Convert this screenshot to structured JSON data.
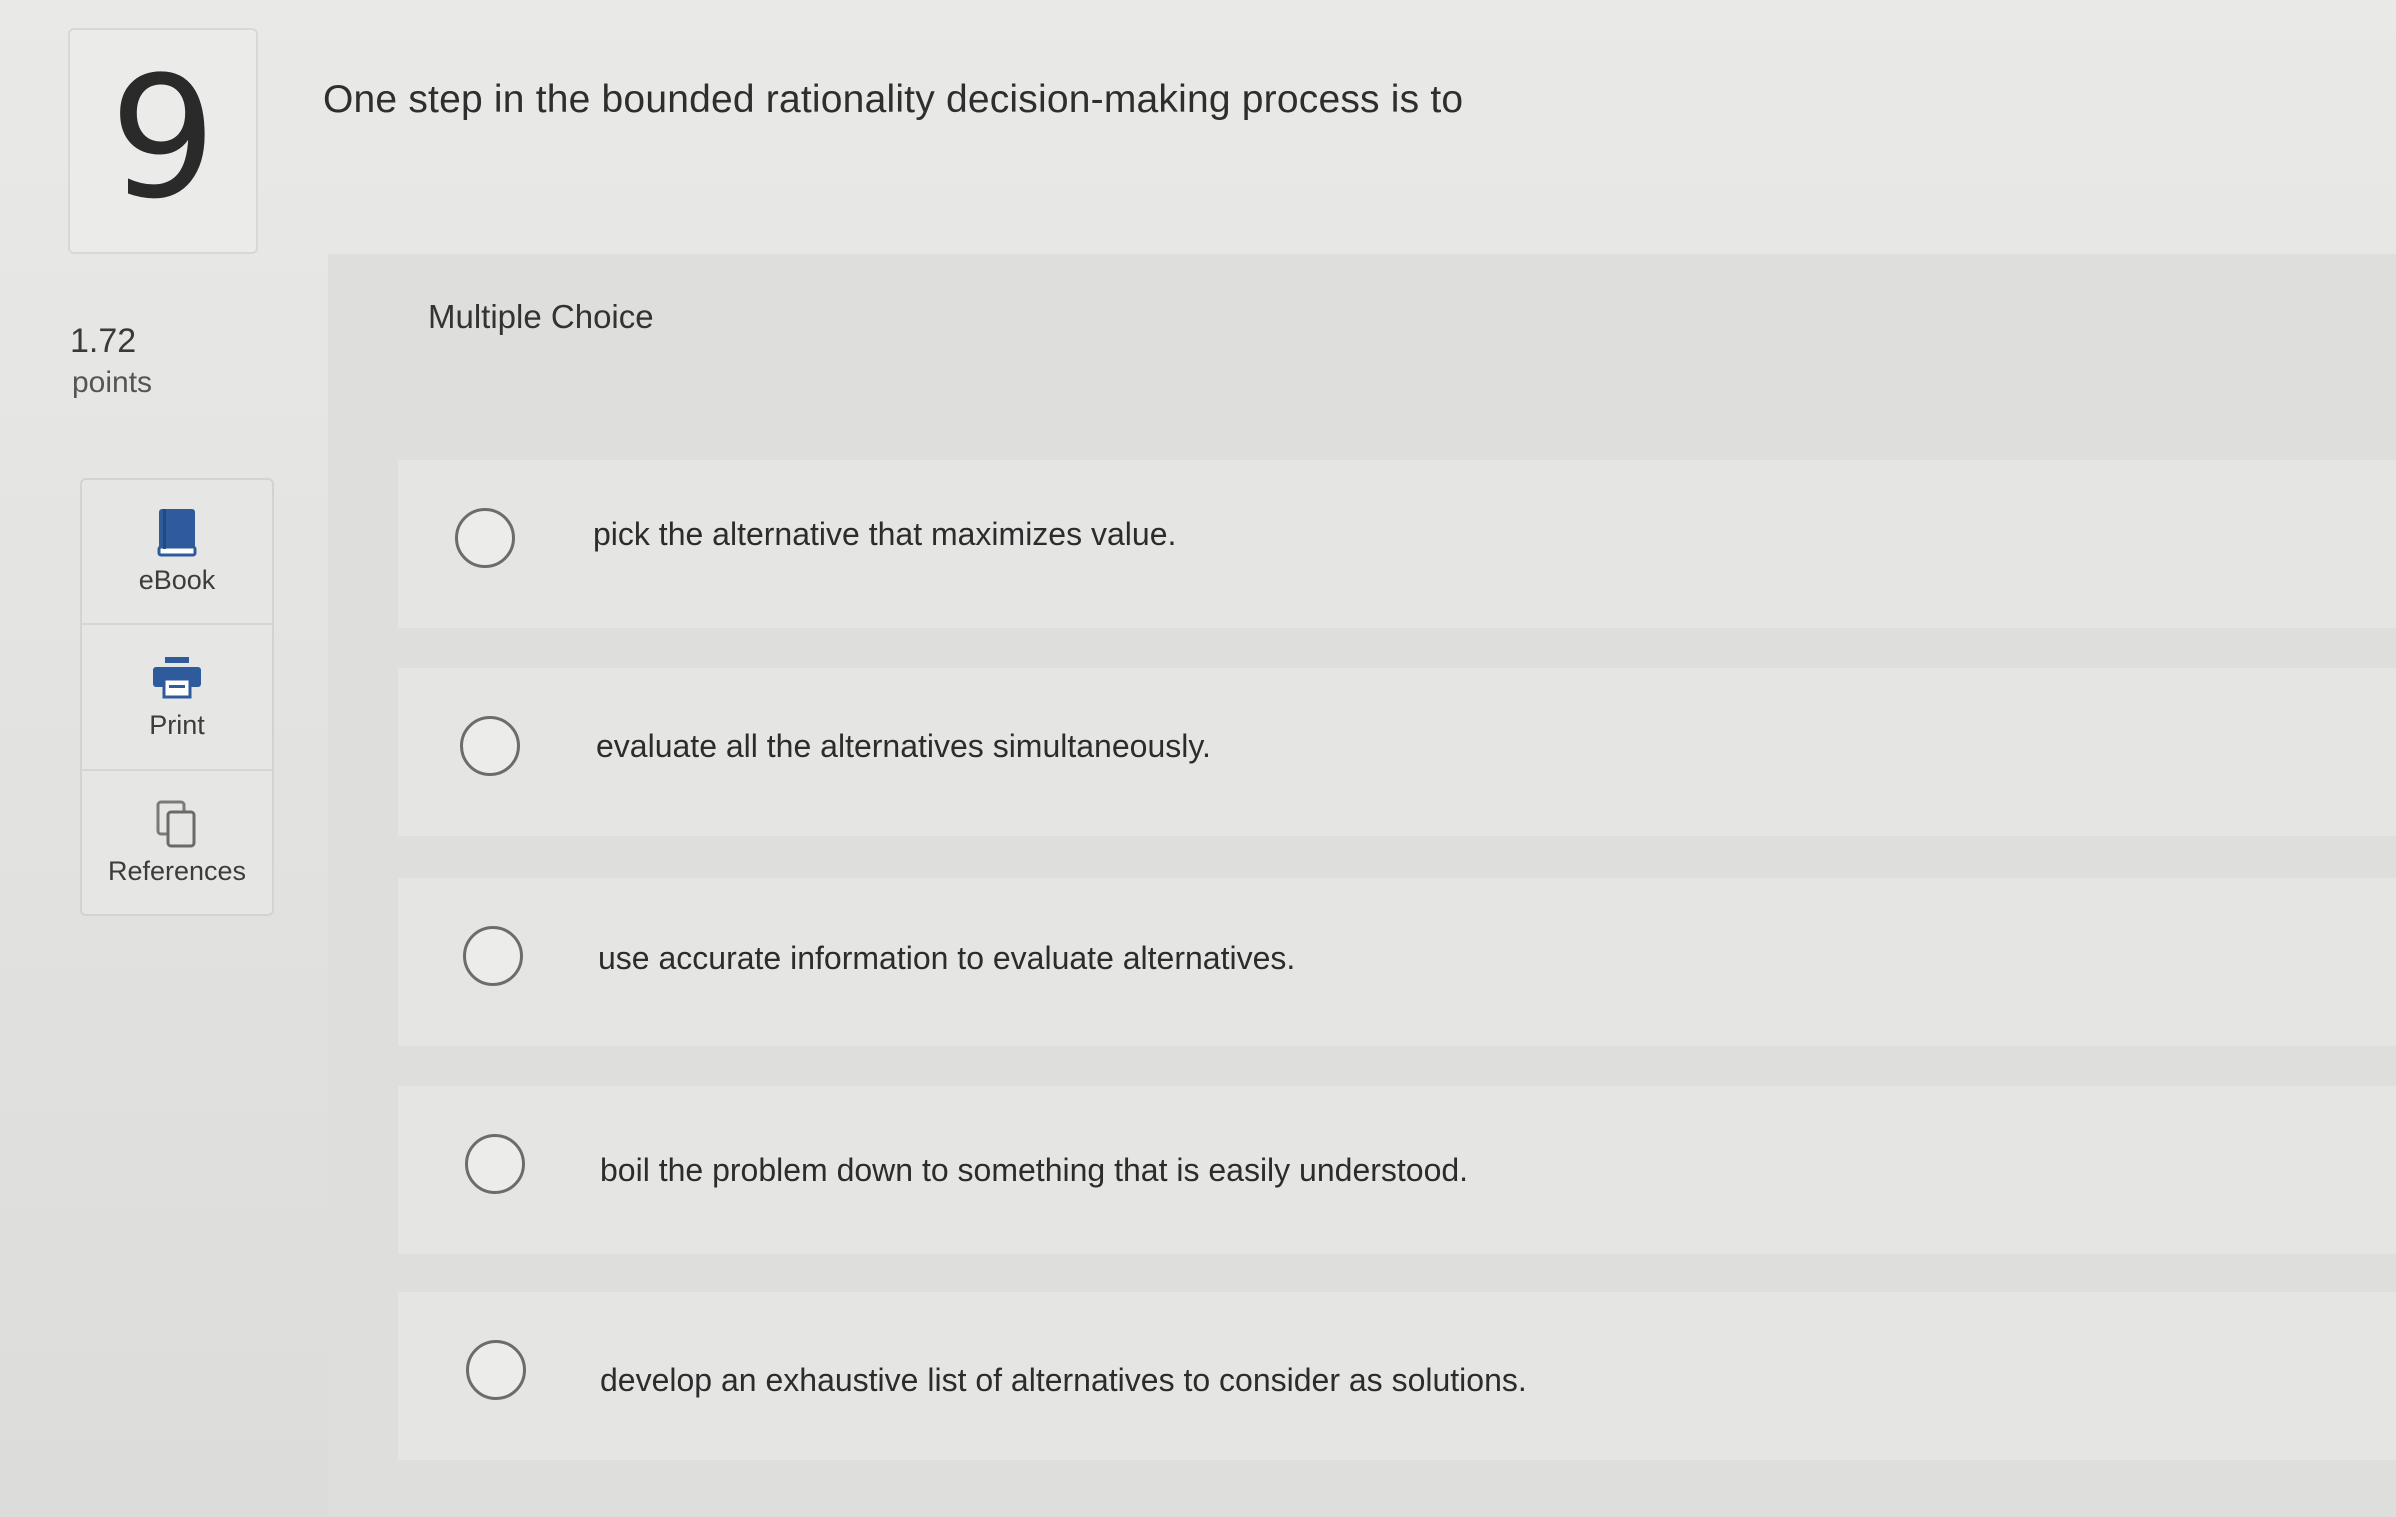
{
  "question": {
    "number": "9",
    "text": "One step in the bounded rationality decision-making process is to",
    "points_value": "1.72",
    "points_label": "points",
    "type_label": "Multiple Choice"
  },
  "tools": [
    {
      "label": "eBook",
      "icon": "book-icon"
    },
    {
      "label": "Print",
      "icon": "printer-icon"
    },
    {
      "label": "References",
      "icon": "copy-icon"
    }
  ],
  "options": [
    {
      "text": "pick the alternative that maximizes value.",
      "selected": false
    },
    {
      "text": "evaluate all the alternatives simultaneously.",
      "selected": false
    },
    {
      "text": "use accurate information to evaluate alternatives.",
      "selected": false
    },
    {
      "text": "boil the problem down to something that is easily understood.",
      "selected": false
    },
    {
      "text": "develop an exhaustive list of alternatives to consider as solutions.",
      "selected": false
    }
  ],
  "colors": {
    "ebook_icon": "#2f5b9c",
    "print_icon": "#2f5b9c",
    "references_icon": "#7a7a7a"
  }
}
